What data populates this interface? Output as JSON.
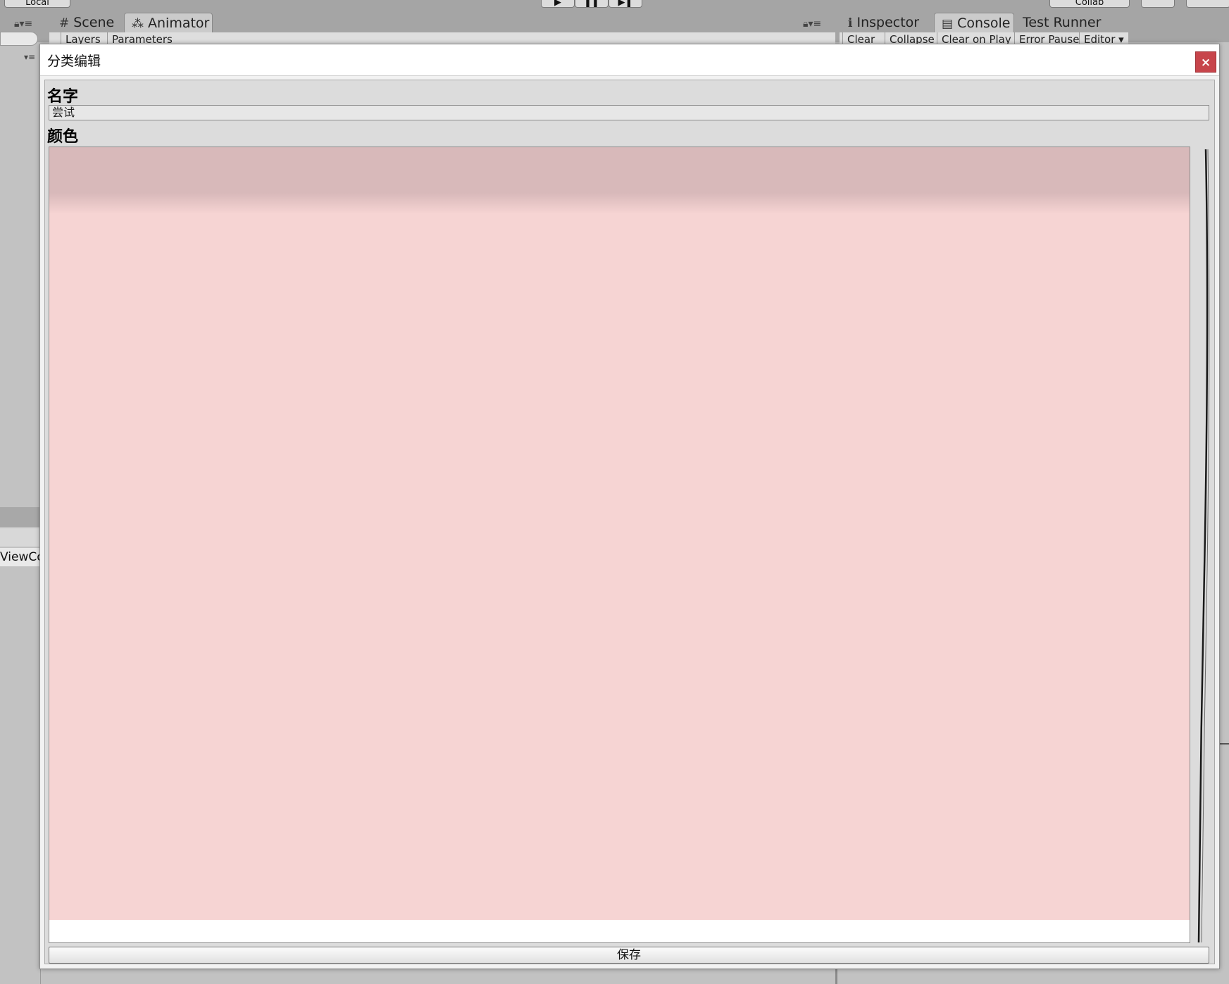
{
  "editor": {
    "toolbar": {
      "account_label": "Local",
      "collab_label": "Collab"
    },
    "left_tabs": [
      {
        "label": "Scene",
        "icon": "grid-icon"
      },
      {
        "label": "Animator",
        "icon": "animator-icon"
      }
    ],
    "animator_toolbar": {
      "layers_label": "Layers",
      "parameters_label": "Parameters"
    },
    "right_tabs": [
      {
        "label": "Inspector",
        "icon": "info-icon"
      },
      {
        "label": "Console",
        "icon": "console-icon"
      },
      {
        "label": "Test Runner"
      }
    ],
    "console_toolbar": [
      "Clear",
      "Collapse",
      "Clear on Play",
      "Error Pause",
      "Editor"
    ],
    "left_panel_text": "ViewCo"
  },
  "dialog": {
    "title": "分类编辑",
    "close_label": "×",
    "name_label": "名字",
    "name_value": "尝试",
    "color_label": "颜色",
    "color_value": "#f6d4d3",
    "save_label": "保存"
  }
}
